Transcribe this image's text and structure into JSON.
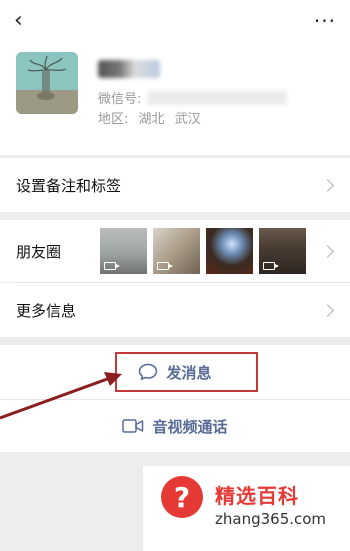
{
  "header": {
    "back_icon": "chevron-left-icon",
    "more_icon": "more-dots-icon"
  },
  "profile": {
    "wechat_id_label": "微信号:",
    "region_label": "地区:",
    "region_province": "湖北",
    "region_city": "武汉"
  },
  "menu": {
    "remark_tags": "设置备注和标签",
    "moments": "朋友圈",
    "more_info": "更多信息"
  },
  "actions": {
    "send_message": "发消息",
    "av_call": "音视频通话"
  },
  "watermark": {
    "symbol": "?",
    "title": "精选百科",
    "url": "zhang365.com"
  },
  "colors": {
    "link": "#576b95",
    "highlight": "#c43a3a",
    "arrow": "#8b1e1e"
  }
}
